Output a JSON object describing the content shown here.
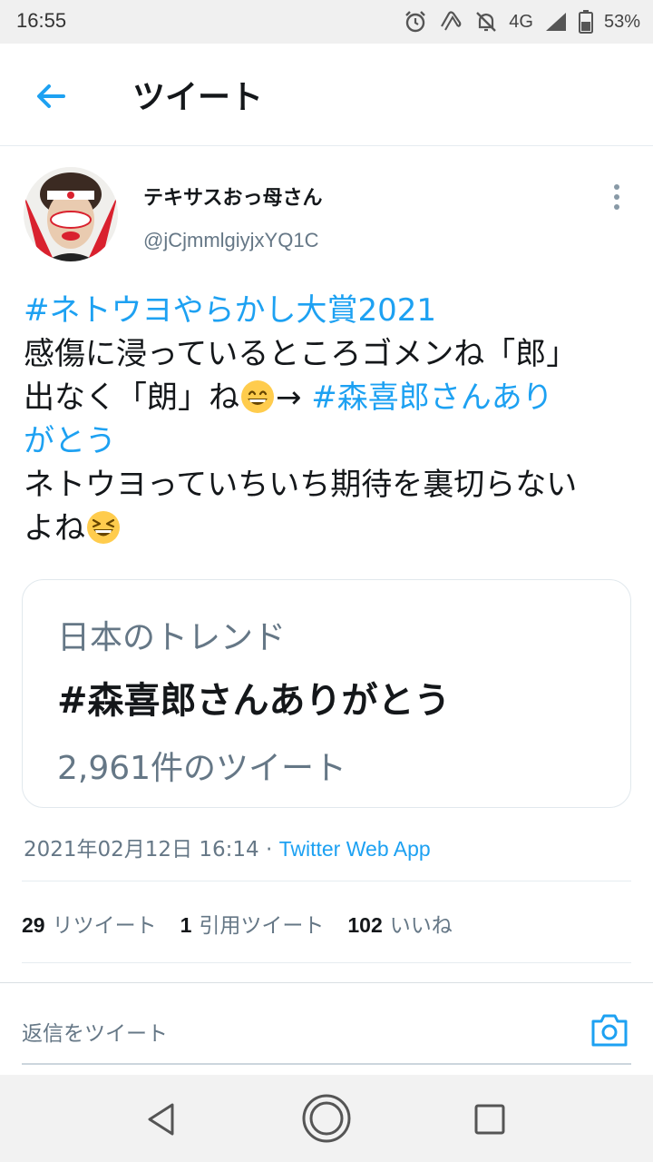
{
  "status_bar": {
    "time": "16:55",
    "network": "4G",
    "battery": "53%",
    "icons": [
      "alarm-icon",
      "nfc-icon",
      "notifications-off-icon",
      "signal-icon",
      "battery-icon"
    ]
  },
  "header": {
    "title": "ツイート",
    "back_icon": "arrow-left-icon"
  },
  "author": {
    "display_name": "テキサスおっ母さん",
    "handle": "@jCjmmlgiyjxYQ1C"
  },
  "tweet": {
    "line1_hashtag": "#ネトウヨやらかし大賞2021",
    "line2": "感傷に浸っているところゴメンね「郎」",
    "line3_text": "出なく「朗」ね",
    "line3_arrow": "→ ",
    "line3_hashtag": "#森喜郎さんあり",
    "line4_hashtag": "がとう",
    "line5": "ネトウヨっていちいち期待を裏切らない",
    "line6": "よね",
    "emojis": [
      "grinning-face-emoji",
      "laughing-face-emoji"
    ]
  },
  "embedded_card": {
    "label": "日本のトレンド",
    "hashtag": "#森喜郎さんありがとう",
    "count": "2,961件のツイート"
  },
  "meta": {
    "timestamp": "2021年02月12日 16:14",
    "separator": "·",
    "source": "Twitter Web App"
  },
  "stats": {
    "retweets_count": "29",
    "retweets_label": "リツイート",
    "quotes_count": "1",
    "quotes_label": "引用ツイート",
    "likes_count": "102",
    "likes_label": "いいね"
  },
  "reply": {
    "placeholder": "返信をツイート"
  },
  "colors": {
    "accent": "#1da1f2",
    "text": "#14171a",
    "secondary": "#657786",
    "border": "#e6ecf0"
  }
}
